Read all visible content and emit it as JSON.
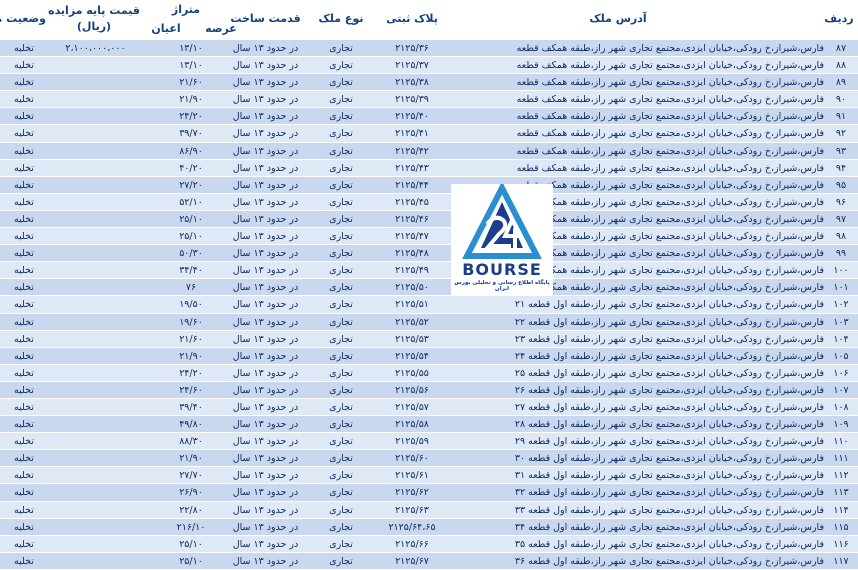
{
  "header": {
    "row_no": "ردیف",
    "address": "آدرس ملک",
    "plate": "پلاک ثبتی",
    "type": "نوع ملک",
    "age": "قدمت ساخت",
    "area": "متراژ",
    "area_land": "عرصه",
    "area_building": "اعیان",
    "price_line1": "قیمت پایه مزایده",
    "price_line2": "(ریال)",
    "status": "وضعیت ملک"
  },
  "logo": {
    "name": "BOURSE",
    "tagline": "پایگاه اطلاع رسانی و تحلیلی بورس ایران"
  },
  "rows": [
    {
      "no": "۸۷",
      "addr": "فارس،شیراز،خ رودکی،خیابان ایزدی،مجتمع تجاری شهر راز،طبقه همکف قطعه ۱",
      "plate": "۲۱۲۵/۳۶",
      "type": "تجاری",
      "age": "در حدود ۱۳ سال",
      "area": "۱۳/۱۰",
      "price": "۲،۱۰۰،۰۰۰،۰۰۰",
      "status": "تخلیه"
    },
    {
      "no": "۸۸",
      "addr": "فارس،شیراز،خ رودکی،خیابان ایزدی،مجتمع تجاری شهر راز،طبقه همکف قطعه ۲",
      "plate": "۲۱۲۵/۳۷",
      "type": "تجاری",
      "age": "در حدود ۱۳ سال",
      "area": "۱۳/۱۰",
      "price": "",
      "status": "تخلیه"
    },
    {
      "no": "۸۹",
      "addr": "فارس،شیراز،خ رودکی،خیابان ایزدی،مجتمع تجاری شهر راز،طبقه همکف قطعه ۳",
      "plate": "۲۱۲۵/۳۸",
      "type": "تجاری",
      "age": "در حدود ۱۳ سال",
      "area": "۲۱/۶۰",
      "price": "",
      "status": "تخلیه"
    },
    {
      "no": "۹۰",
      "addr": "فارس،شیراز،خ رودکی،خیابان ایزدی،مجتمع تجاری شهر راز،طبقه همکف قطعه ۴",
      "plate": "۲۱۲۵/۳۹",
      "type": "تجاری",
      "age": "در حدود ۱۳ سال",
      "area": "۲۱/۹۰",
      "price": "",
      "status": "تخلیه"
    },
    {
      "no": "۹۱",
      "addr": "فارس،شیراز،خ رودکی،خیابان ایزدی،مجتمع تجاری شهر راز،طبقه همکف قطعه ۵",
      "plate": "۲۱۲۵/۴۰",
      "type": "تجاری",
      "age": "در حدود ۱۳ سال",
      "area": "۲۴/۲۰",
      "price": "",
      "status": "تخلیه"
    },
    {
      "no": "۹۲",
      "addr": "فارس،شیراز،خ رودکی،خیابان ایزدی،مجتمع تجاری شهر راز،طبقه همکف قطعه ۶",
      "plate": "۲۱۲۵/۴۱",
      "type": "تجاری",
      "age": "در حدود ۱۳ سال",
      "area": "۳۹/۷۰",
      "price": "",
      "status": "تخلیه"
    },
    {
      "no": "۹۳",
      "addr": "فارس،شیراز،خ رودکی،خیابان ایزدی،مجتمع تجاری شهر راز،طبقه همکف قطعه ۸",
      "plate": "۲۱۲۵/۴۲",
      "type": "تجاری",
      "age": "در حدود ۱۳ سال",
      "area": "۸۶/۹۰",
      "price": "",
      "status": "تخلیه"
    },
    {
      "no": "۹۴",
      "addr": "فارس،شیراز،خ رودکی،خیابان ایزدی،مجتمع تجاری شهر راز،طبقه همکف قطعه ۹",
      "plate": "۲۱۲۵/۴۳",
      "type": "تجاری",
      "age": "در حدود ۱۳ سال",
      "area": "۴۰/۲۰",
      "price": "",
      "status": "تخلیه"
    },
    {
      "no": "۹۵",
      "addr": "فارس،شیراز،خ رودکی،خیابان ایزدی،مجتمع تجاری شهر راز،طبقه همکف قطعه ۱۰",
      "plate": "۲۱۲۵/۴۴",
      "type": "تجاری",
      "age": "در حدود ۱۳ سال",
      "area": "۲۷/۲۰",
      "price": "",
      "status": "تخلیه"
    },
    {
      "no": "۹۶",
      "addr": "فارس،شیراز،خ رودکی،خیابان ایزدی،مجتمع تجاری شهر راز،طبقه همکف قطعه ۱۱",
      "plate": "۲۱۲۵/۴۵",
      "type": "تجاری",
      "age": "در حدود ۱۳ سال",
      "area": "۵۲/۱۰",
      "price": "",
      "status": "تخلیه"
    },
    {
      "no": "۹۷",
      "addr": "فارس،شیراز،خ رودکی،خیابان ایزدی،مجتمع تجاری شهر راز،طبقه همکف قطعه ۱۲",
      "plate": "۲۱۲۵/۴۶",
      "type": "تجاری",
      "age": "در حدود ۱۳ سال",
      "area": "۲۵/۱۰",
      "price": "",
      "status": "تخلیه"
    },
    {
      "no": "۹۸",
      "addr": "فارس،شیراز،خ رودکی،خیابان ایزدی،مجتمع تجاری شهر راز،طبقه همکف قطعه ۱۳",
      "plate": "۲۱۲۵/۴۷",
      "type": "تجاری",
      "age": "در حدود ۱۳ سال",
      "area": "۲۵/۱۰",
      "price": "",
      "status": "تخلیه"
    },
    {
      "no": "۹۹",
      "addr": "فارس،شیراز،خ رودکی،خیابان ایزدی،مجتمع تجاری شهر راز،طبقه همکف قطعه ۱۴",
      "plate": "۲۱۲۵/۴۸",
      "type": "تجاری",
      "age": "در حدود ۱۳ سال",
      "area": "۵۰/۳۰",
      "price": "",
      "status": "تخلیه"
    },
    {
      "no": "۱۰۰",
      "addr": "فارس،شیراز،خ رودکی،خیابان ایزدی،مجتمع تجاری شهر راز،طبقه همکف قطعه ۱۹",
      "plate": "۲۱۲۵/۴۹",
      "type": "تجاری",
      "age": "در حدود ۱۳ سال",
      "area": "۳۴/۴۰",
      "price": "",
      "status": "تخلیه"
    },
    {
      "no": "۱۰۱",
      "addr": "فارس،شیراز،خ رودکی،خیابان ایزدی،مجتمع تجاری شهر راز،طبقه همکف قطعه ۲۰",
      "plate": "۲۱۲۵/۵۰",
      "type": "تجاری",
      "age": "در حدود ۱۳ سال",
      "area": "۷۶",
      "price": "",
      "status": "تخلیه"
    },
    {
      "no": "۱۰۲",
      "addr": "فارس،شیراز،خ رودکی،خیابان ایزدی،مجتمع تجاری شهر راز،طبقه اول قطعه ۲۱",
      "plate": "۲۱۲۵/۵۱",
      "type": "تجاری",
      "age": "در حدود ۱۳ سال",
      "area": "۱۹/۵۰",
      "price": "",
      "status": "تخلیه"
    },
    {
      "no": "۱۰۳",
      "addr": "فارس،شیراز،خ رودکی،خیابان ایزدی،مجتمع تجاری شهر راز،طبقه اول قطعه ۲۲",
      "plate": "۲۱۲۵/۵۲",
      "type": "تجاری",
      "age": "در حدود ۱۳ سال",
      "area": "۱۹/۶۰",
      "price": "",
      "status": "تخلیه"
    },
    {
      "no": "۱۰۴",
      "addr": "فارس،شیراز،خ رودکی،خیابان ایزدی،مجتمع تجاری شهر راز،طبقه اول قطعه ۲۳",
      "plate": "۲۱۲۵/۵۳",
      "type": "تجاری",
      "age": "در حدود ۱۳ سال",
      "area": "۲۱/۶۰",
      "price": "",
      "status": "تخلیه"
    },
    {
      "no": "۱۰۵",
      "addr": "فارس،شیراز،خ رودکی،خیابان ایزدی،مجتمع تجاری شهر راز،طبقه اول قطعه ۲۴",
      "plate": "۲۱۲۵/۵۴",
      "type": "تجاری",
      "age": "در حدود ۱۳ سال",
      "area": "۲۱/۹۰",
      "price": "",
      "status": "تخلیه"
    },
    {
      "no": "۱۰۶",
      "addr": "فارس،شیراز،خ رودکی،خیابان ایزدی،مجتمع تجاری شهر راز،طبقه اول قطعه ۲۵",
      "plate": "۲۱۲۵/۵۵",
      "type": "تجاری",
      "age": "در حدود ۱۳ سال",
      "area": "۲۴/۲۰",
      "price": "",
      "status": "تخلیه"
    },
    {
      "no": "۱۰۷",
      "addr": "فارس،شیراز،خ رودکی،خیابان ایزدی،مجتمع تجاری شهر راز،طبقه اول قطعه ۲۶",
      "plate": "۲۱۲۵/۵۶",
      "type": "تجاری",
      "age": "در حدود ۱۳ سال",
      "area": "۲۴/۶۰",
      "price": "",
      "status": "تخلیه"
    },
    {
      "no": "۱۰۸",
      "addr": "فارس،شیراز،خ رودکی،خیابان ایزدی،مجتمع تجاری شهر راز،طبقه اول قطعه ۲۷",
      "plate": "۲۱۲۵/۵۷",
      "type": "تجاری",
      "age": "در حدود ۱۳ سال",
      "area": "۳۹/۴۰",
      "price": "",
      "status": "تخلیه"
    },
    {
      "no": "۱۰۹",
      "addr": "فارس،شیراز،خ رودکی،خیابان ایزدی،مجتمع تجاری شهر راز،طبقه اول قطعه ۲۸",
      "plate": "۲۱۲۵/۵۸",
      "type": "تجاری",
      "age": "در حدود ۱۳ سال",
      "area": "۴۹/۸۰",
      "price": "",
      "status": "تخلیه"
    },
    {
      "no": "۱۱۰",
      "addr": "فارس،شیراز،خ رودکی،خیابان ایزدی،مجتمع تجاری شهر راز،طبقه اول قطعه ۲۹",
      "plate": "۲۱۲۵/۵۹",
      "type": "تجاری",
      "age": "در حدود ۱۳ سال",
      "area": "۸۸/۳۰",
      "price": "",
      "status": "تخلیه"
    },
    {
      "no": "۱۱۱",
      "addr": "فارس،شیراز،خ رودکی،خیابان ایزدی،مجتمع تجاری شهر راز،طبقه اول قطعه ۳۰",
      "plate": "۲۱۲۵/۶۰",
      "type": "تجاری",
      "age": "در حدود ۱۳ سال",
      "area": "۲۱/۹۰",
      "price": "",
      "status": "تخلیه"
    },
    {
      "no": "۱۱۲",
      "addr": "فارس،شیراز،خ رودکی،خیابان ایزدی،مجتمع تجاری شهر راز،طبقه اول قطعه ۳۱",
      "plate": "۲۱۲۵/۶۱",
      "type": "تجاری",
      "age": "در حدود ۱۳ سال",
      "area": "۲۷/۷۰",
      "price": "",
      "status": "تخلیه"
    },
    {
      "no": "۱۱۳",
      "addr": "فارس،شیراز،خ رودکی،خیابان ایزدی،مجتمع تجاری شهر راز،طبقه اول قطعه ۳۲",
      "plate": "۲۱۲۵/۶۲",
      "type": "تجاری",
      "age": "در حدود ۱۳ سال",
      "area": "۲۶/۹۰",
      "price": "",
      "status": "تخلیه"
    },
    {
      "no": "۱۱۴",
      "addr": "فارس،شیراز،خ رودکی،خیابان ایزدی،مجتمع تجاری شهر راز،طبقه اول قطعه ۳۳",
      "plate": "۲۱۲۵/۶۳",
      "type": "تجاری",
      "age": "در حدود ۱۳ سال",
      "area": "۲۲/۸۰",
      "price": "",
      "status": "تخلیه"
    },
    {
      "no": "۱۱۵",
      "addr": "فارس،شیراز،خ رودکی،خیابان ایزدی،مجتمع تجاری شهر راز،طبقه اول قطعه ۳۴",
      "plate": "۲۱۲۵/۶۴،۶۵",
      "type": "تجاری",
      "age": "در حدود ۱۳ سال",
      "area": "۲۱۶/۱۰",
      "price": "",
      "status": "تخلیه"
    },
    {
      "no": "۱۱۶",
      "addr": "فارس،شیراز،خ رودکی،خیابان ایزدی،مجتمع تجاری شهر راز،طبقه اول قطعه ۳۵",
      "plate": "۲۱۲۵/۶۶",
      "type": "تجاری",
      "age": "در حدود ۱۳ سال",
      "area": "۲۵/۱۰",
      "price": "",
      "status": "تخلیه"
    },
    {
      "no": "۱۱۷",
      "addr": "فارس،شیراز،خ رودکی،خیابان ایزدی،مجتمع تجاری شهر راز،طبقه اول قطعه ۳۶",
      "plate": "۲۱۲۵/۶۷",
      "type": "تجاری",
      "age": "در حدود ۱۳ سال",
      "area": "۲۵/۱۰",
      "price": "",
      "status": "تخلیه"
    }
  ]
}
